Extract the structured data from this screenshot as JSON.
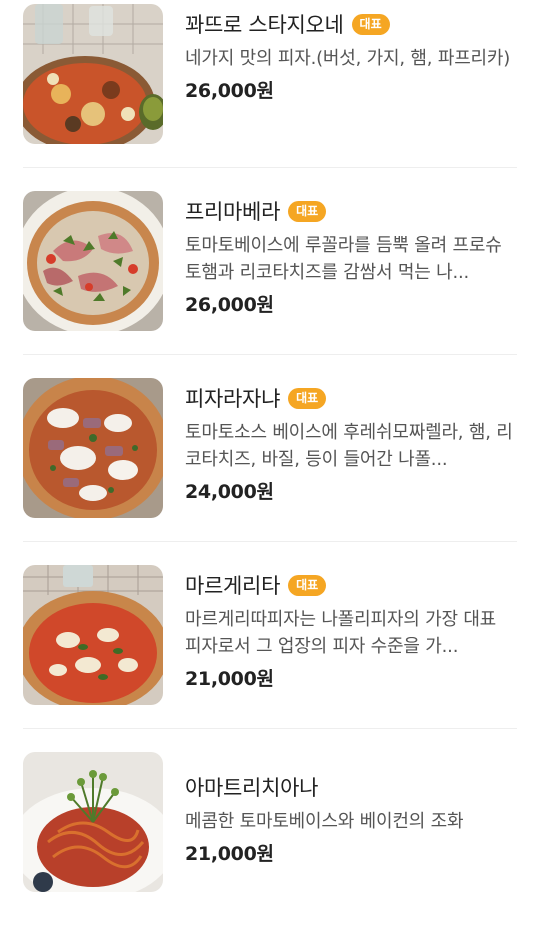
{
  "menu": {
    "items": [
      {
        "name": "꽈뜨로 스타지오네",
        "badge": "대표",
        "description": "네가지 맛의 피자.(버섯, 가지, 햄, 파프리카)",
        "price": "26,000원",
        "image_icon": "pizza-photo"
      },
      {
        "name": "프리마베라",
        "badge": "대표",
        "description": "토마토베이스에 루꼴라를 듬뿍 올려 프로슈토햄과 리코타치즈를 감쌈서 먹는 나...",
        "price": "26,000원",
        "image_icon": "pizza-photo"
      },
      {
        "name": "피자라자냐",
        "badge": "대표",
        "description": "토마토소스 베이스에 후레쉬모짜렐라, 햄, 리코타치즈, 바질, 등이 들어간 나폴...",
        "price": "24,000원",
        "image_icon": "pizza-photo"
      },
      {
        "name": "마르게리타",
        "badge": "대표",
        "description": "마르게리따피자는 나폴리피자의 가장 대표 피자로서 그 업장의 피자 수준을 가...",
        "price": "21,000원",
        "image_icon": "pizza-photo"
      },
      {
        "name": "아마트리치아나",
        "description": "메콤한 토마토베이스와 베이컨의 조화",
        "price": "21,000원",
        "image_icon": "pasta-photo"
      }
    ]
  }
}
